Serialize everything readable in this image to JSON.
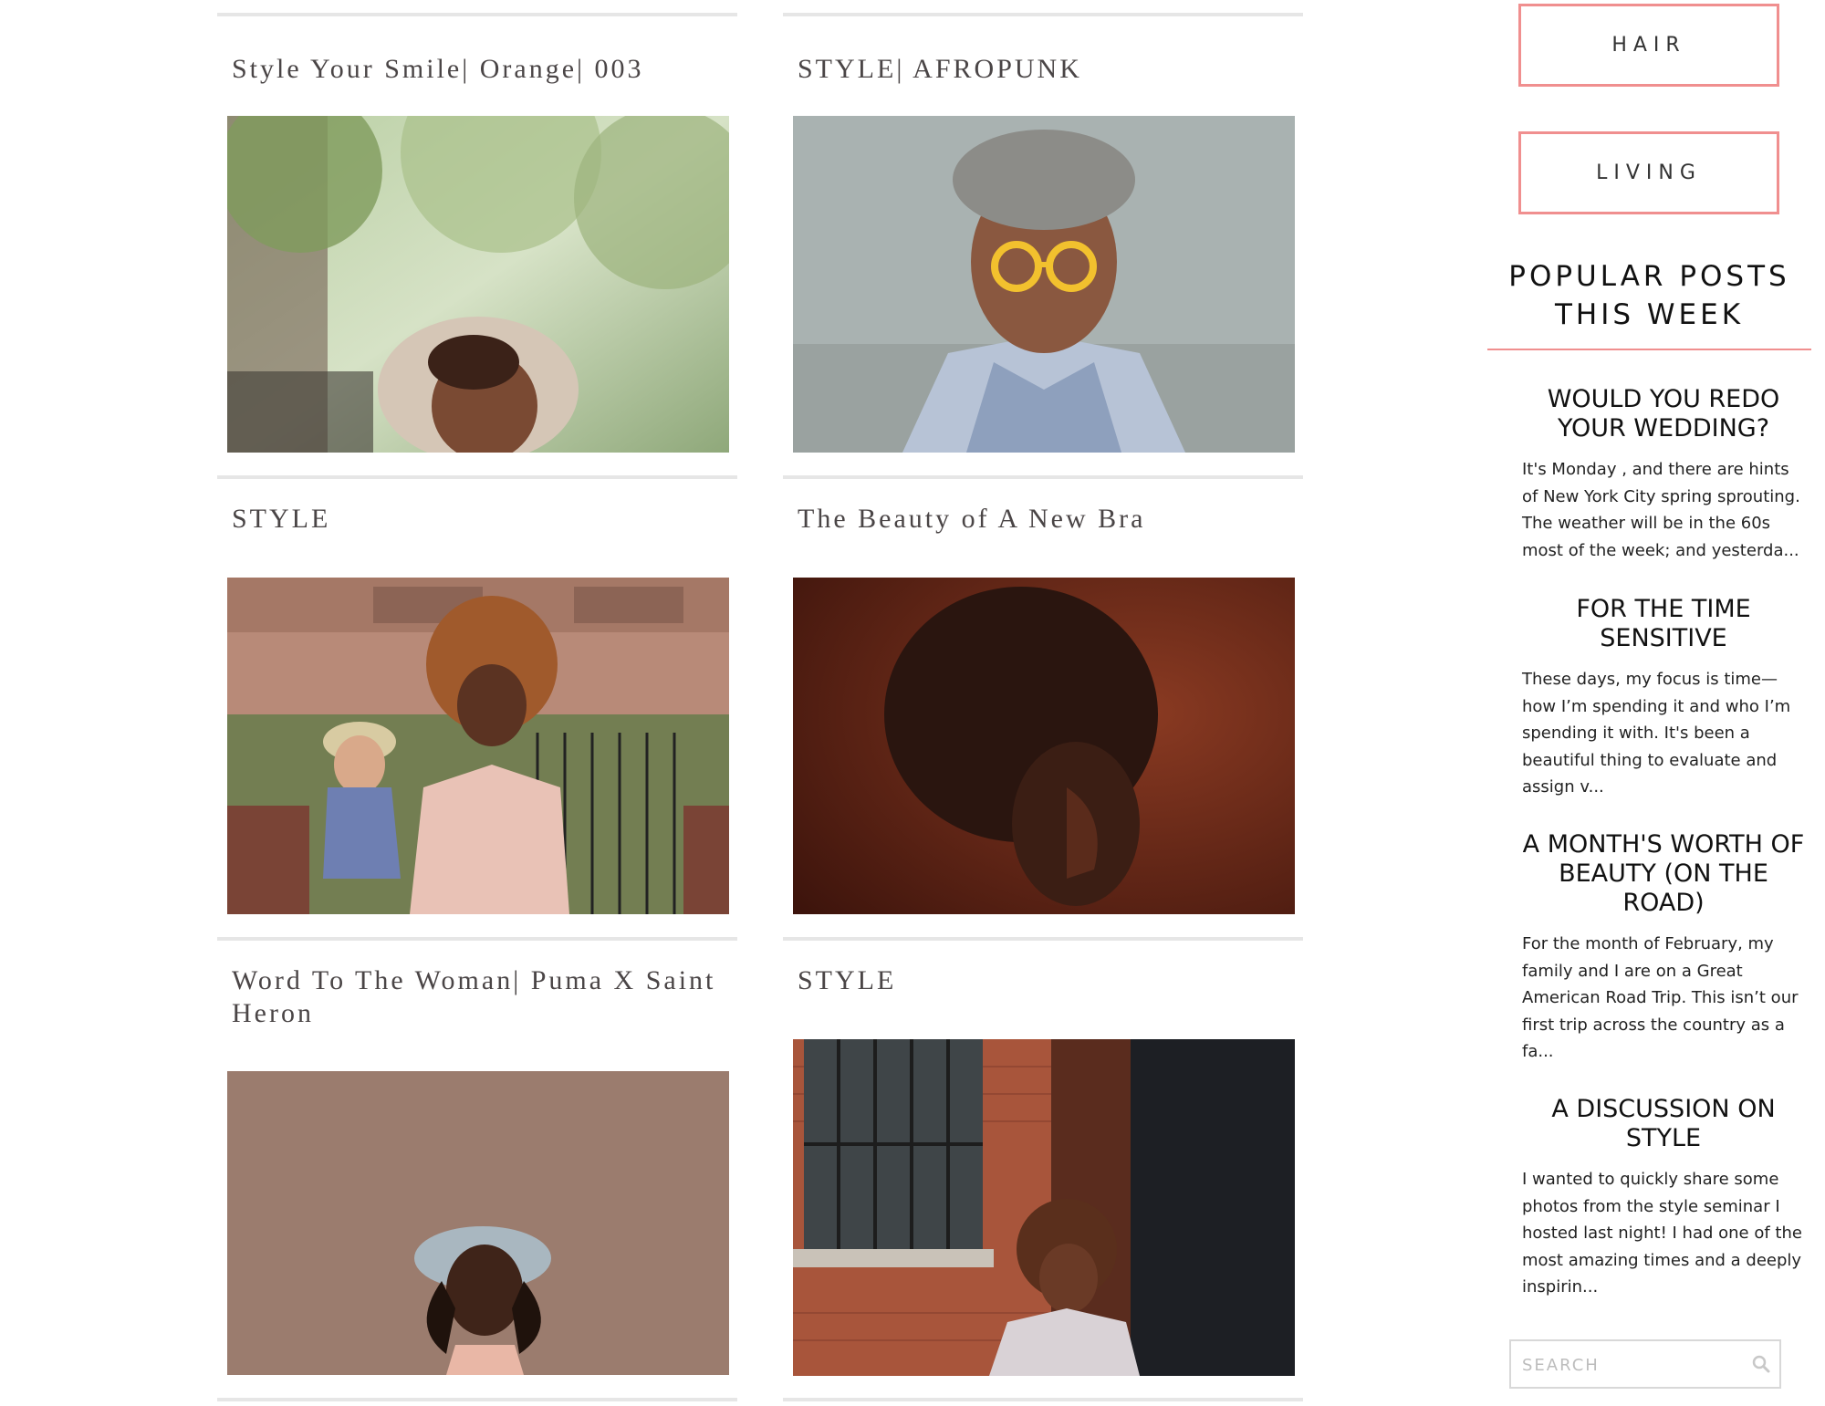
{
  "posts": [
    {
      "title": "Style Your Smile| Orange| 003"
    },
    {
      "title": "STYLE| AFROPUNK"
    },
    {
      "title": "STYLE"
    },
    {
      "title": "The Beauty of A New Bra"
    },
    {
      "title": "Word To The Woman| Puma X Saint Heron"
    },
    {
      "title": "STYLE"
    }
  ],
  "sidebar": {
    "categories": [
      "HAIR",
      "LIVING"
    ],
    "popular_heading_line1": "POPULAR POSTS",
    "popular_heading_line2": "THIS WEEK",
    "popular_posts": [
      {
        "title": "WOULD YOU REDO YOUR WEDDING?",
        "excerpt": "It's  Monday , and there are hints of New York City spring sprouting. The weather will be in the 60s most of the week; and yesterda..."
      },
      {
        "title": "FOR THE TIME SENSITIVE",
        "excerpt": "These days, my focus is time—how I’m spending it and who I’m spending it with. It's been a beautiful thing to evaluate and assign v..."
      },
      {
        "title": "A MONTH'S WORTH OF BEAUTY (ON THE ROAD)",
        "excerpt": "For the month of February, my family and I are on a Great American Road Trip. This isn’t our first trip across the country as a fa..."
      },
      {
        "title": "A DISCUSSION ON STYLE",
        "excerpt": "I wanted to quickly share some photos from the style seminar I hosted last night! I had one of the most amazing times and a deeply inspirin..."
      }
    ],
    "search_placeholder": "SEARCH",
    "search_icon": "magnifier-icon"
  },
  "colors": {
    "accent": "#f08f8f",
    "rule": "#e6e6e6",
    "title_text": "#4a4546"
  }
}
